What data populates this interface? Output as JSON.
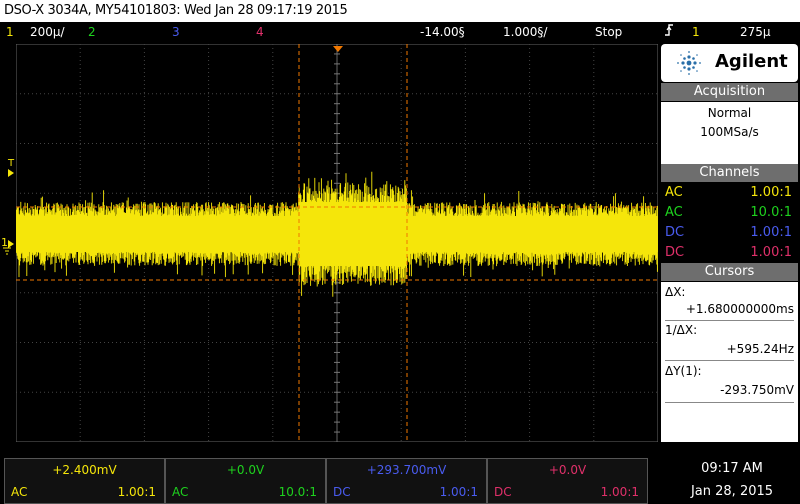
{
  "title": "DSO-X 3034A, MY54101803: Wed Jan 28 09:17:19 2015",
  "status": {
    "ch1_num": "1",
    "ch1_scale": "200µ/",
    "ch2_num": "2",
    "ch3_num": "3",
    "ch4_num": "4",
    "time_delay": "-14.00§",
    "time_scale": "1.000§/",
    "run_state": "Stop",
    "trig_icon": "trigger-edge-icon",
    "trig_ch": "1",
    "trig_level": "275µ"
  },
  "colors": {
    "ch1": "#f5e60a",
    "ch2": "#1ed21e",
    "ch3": "#4a5cf0",
    "ch4": "#e0306a",
    "cursor": "#f07800"
  },
  "markers": {
    "trigger_level": "T",
    "ch1_ground": "1"
  },
  "side": {
    "brand": "Agilent",
    "acquisition": {
      "header": "Acquisition",
      "mode": "Normal",
      "rate": "100MSa/s"
    },
    "channels": {
      "header": "Channels",
      "rows": [
        {
          "coupling": "AC",
          "probe": "1.00:1"
        },
        {
          "coupling": "AC",
          "probe": "10.0:1"
        },
        {
          "coupling": "DC",
          "probe": "1.00:1"
        },
        {
          "coupling": "DC",
          "probe": "1.00:1"
        }
      ]
    },
    "cursors": {
      "header": "Cursors",
      "dx_label": "ΔX:",
      "dx_value": "+1.680000000ms",
      "inv_dx_label": "1/ΔX:",
      "inv_dx_value": "+595.24Hz",
      "dy_label": "ΔY(1):",
      "dy_value": "-293.750mV"
    }
  },
  "bottom": {
    "channels": [
      {
        "offset": "+2.400mV",
        "coupling": "AC",
        "probe": "1.00:1"
      },
      {
        "offset": "+0.0V",
        "coupling": "AC",
        "probe": "10.0:1"
      },
      {
        "offset": "+293.700mV",
        "coupling": "DC",
        "probe": "1.00:1"
      },
      {
        "offset": "+0.0V",
        "coupling": "DC",
        "probe": "1.00:1"
      }
    ],
    "time": "09:17 AM",
    "date": "Jan 28, 2015"
  }
}
